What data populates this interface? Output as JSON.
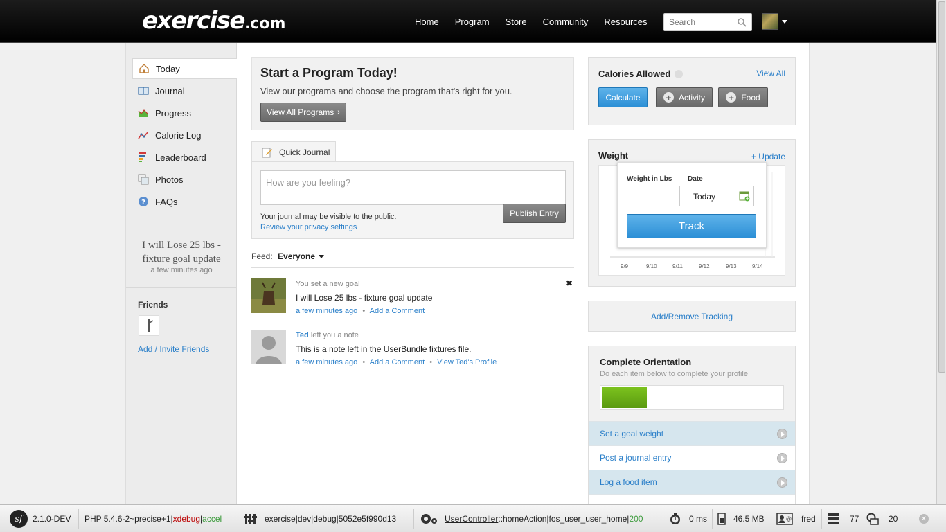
{
  "header": {
    "logo_main": "exercise",
    "logo_suffix": ".com",
    "nav": [
      "Home",
      "Program",
      "Store",
      "Community",
      "Resources"
    ],
    "search_placeholder": "Search"
  },
  "sidebar": {
    "items": [
      {
        "label": "Today",
        "icon": "home-icon"
      },
      {
        "label": "Journal",
        "icon": "book-icon"
      },
      {
        "label": "Progress",
        "icon": "progress-chart-icon"
      },
      {
        "label": "Calorie Log",
        "icon": "line-chart-icon"
      },
      {
        "label": "Leaderboard",
        "icon": "leaderboard-icon"
      },
      {
        "label": "Photos",
        "icon": "photos-icon"
      },
      {
        "label": "FAQs",
        "icon": "help-icon"
      }
    ],
    "goal_text": "I will Lose 25 lbs - fixture goal update",
    "goal_time": "a few minutes ago",
    "friends_heading": "Friends",
    "friends_link": "Add / Invite Friends"
  },
  "promo": {
    "title": "Start a Program Today!",
    "text": "View our programs and choose the program that's right for you.",
    "button": "View All Programs"
  },
  "journal": {
    "tab_label": "Quick Journal",
    "placeholder": "How are you feeling?",
    "note": "Your journal may be visible to the public.",
    "privacy_link": "Review your privacy settings",
    "publish": "Publish Entry"
  },
  "feed": {
    "label": "Feed:",
    "selected": "Everyone",
    "items": [
      {
        "line1": "You set a new goal",
        "line2": "I will Lose 25 lbs - fixture goal update",
        "time": "a few minutes ago",
        "comment": "Add a Comment",
        "dismiss": "✖"
      },
      {
        "name": "Ted",
        "line1_rest": "left you a note",
        "line2": "This is a note left in the UserBundle fixtures file.",
        "time": "a few minutes ago",
        "comment": "Add a Comment",
        "profile": "View Ted's Profile"
      }
    ],
    "dot": "•"
  },
  "calories": {
    "title": "Calories Allowed",
    "view_all": "View All",
    "calculate": "Calculate",
    "activity": "Activity",
    "food": "Food"
  },
  "weight": {
    "title": "Weight",
    "update": "+ Update",
    "label_weight": "Weight in Lbs",
    "label_date": "Date",
    "date_value": "Today",
    "track": "Track",
    "x_ticks": [
      "9/9",
      "9/10",
      "9/11",
      "9/12",
      "9/13",
      "9/14"
    ]
  },
  "tracking": {
    "link": "Add/Remove Tracking"
  },
  "orientation": {
    "title": "Complete Orientation",
    "subtitle": "Do each item below to complete your profile",
    "progress_fraction": 0.25,
    "steps": [
      "Set a goal weight",
      "Post a journal entry",
      "Log a food item"
    ]
  },
  "debug": {
    "version": "2.1.0-DEV",
    "php": "PHP 5.4.6-2~precise+1",
    "xdebug": "xdebug",
    "accel": "accel",
    "pipe": "|",
    "app": "exercise",
    "env": "dev",
    "mode": "debug",
    "token": "5052e5f990d13",
    "controller": "UserController",
    "action": "::homeAction",
    "route": "fos_user_user_home",
    "status": "200",
    "time": "0 ms",
    "memory": "46.5 MB",
    "user": "fred",
    "queries": "77",
    "other": "20"
  },
  "colors": {
    "accent": "#2a7fc9",
    "progress_green": "#6aab15",
    "header_bg": "#000000"
  }
}
